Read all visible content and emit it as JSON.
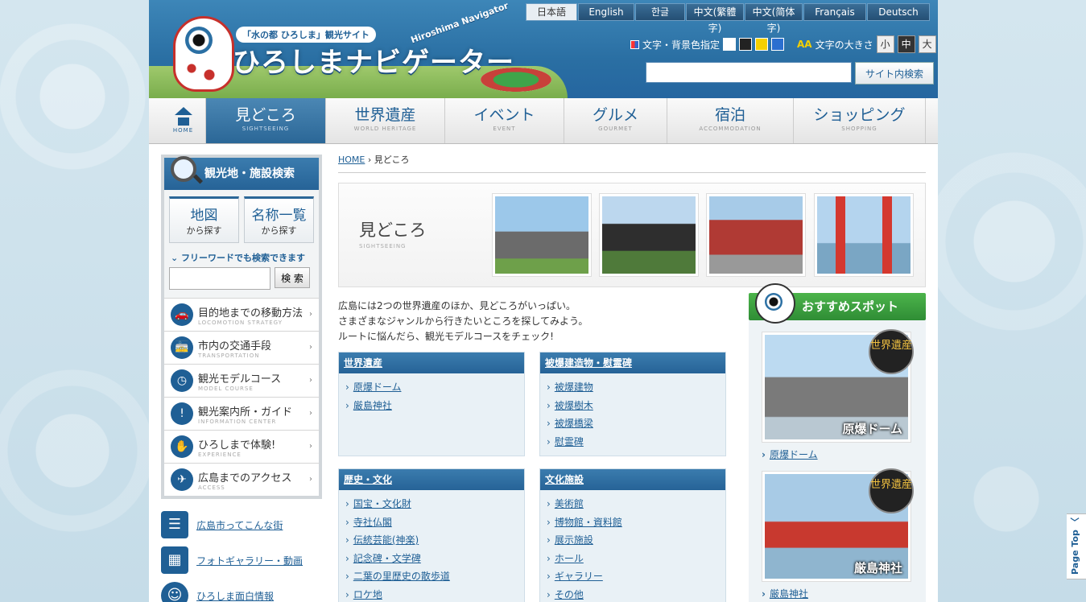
{
  "header": {
    "tagline": "「水の都 ひろしま」観光サイト",
    "site_title": "ひろしまナビゲーター",
    "subtitle": "Hiroshima Navigator",
    "languages": [
      "日本語",
      "English",
      "한글",
      "中文(繁體字)",
      "中文(简体字)",
      "Français",
      "Deutsch"
    ],
    "active_language": "日本語",
    "color_setting_label": "文字・背景色指定",
    "font_size_label": "文字の大きさ",
    "font_sizes": [
      "小",
      "中",
      "大"
    ],
    "active_font_size": "中",
    "search_placeholder": "",
    "search_button": "サイト内検索"
  },
  "nav": {
    "home_label": "HOME",
    "items": [
      {
        "jp": "見どころ",
        "en": "SIGHTSEEING",
        "active": true
      },
      {
        "jp": "世界遺産",
        "en": "WORLD HERITAGE"
      },
      {
        "jp": "イベント",
        "en": "EVENT"
      },
      {
        "jp": "グルメ",
        "en": "GOURMET"
      },
      {
        "jp": "宿泊",
        "en": "ACCOMMODATION"
      },
      {
        "jp": "ショッピング",
        "en": "SHOPPING"
      }
    ]
  },
  "sidebar": {
    "search_title": "観光地・施設検索",
    "map_btn": {
      "main": "地図",
      "sub": "から探す"
    },
    "name_btn": {
      "main": "名称一覧",
      "sub": "から探す"
    },
    "free_word": "フリーワードでも検索できます",
    "free_button": "検 索",
    "menu": [
      {
        "jp": "目的地までの移動方法",
        "en": "LOCOMOTION STRATEGY",
        "icon": "car-icon"
      },
      {
        "jp": "市内の交通手段",
        "en": "TRANSPORTATION",
        "icon": "tram-icon"
      },
      {
        "jp": "観光モデルコース",
        "en": "MODEL COURSE",
        "icon": "clock-icon"
      },
      {
        "jp": "観光案内所・ガイド",
        "en": "INFORMATION CENTER",
        "icon": "info-icon"
      },
      {
        "jp": "ひろしまで体験!",
        "en": "EXPERIENCE",
        "icon": "hand-icon"
      },
      {
        "jp": "広島までのアクセス",
        "en": "ACCESS",
        "icon": "plane-icon"
      }
    ],
    "extras": [
      {
        "label": "広島市ってこんな街",
        "icon": "city-icon"
      },
      {
        "label": "フォトギャラリー・動画",
        "icon": "film-icon"
      },
      {
        "label": "ひろしま面白情報",
        "icon": "smile-icon"
      }
    ]
  },
  "main": {
    "breadcrumb_home": "HOME",
    "breadcrumb_current": "見どころ",
    "hero_title": "見どころ",
    "hero_en": "SIGHTSEEING",
    "intro": [
      "広島には2つの世界遺産のほか、見どころがいっぱい。",
      "さまざまなジャンルから行きたいところを探してみよう。",
      "ルートに悩んだら、観光モデルコースをチェック!"
    ],
    "categories": [
      {
        "title": "世界遺産",
        "links": [
          "原爆ドーム",
          "厳島神社"
        ]
      },
      {
        "title": "被爆建造物・慰霊碑",
        "links": [
          "被爆建物",
          "被爆樹木",
          "被爆橋梁",
          "慰霊碑"
        ]
      },
      {
        "title": "歴史・文化",
        "links": [
          "国宝・文化財",
          "寺社仏閣",
          "伝統芸能(神楽)",
          "記念碑・文学碑",
          "二葉の里歴史の散歩道",
          "ロケ地"
        ]
      },
      {
        "title": "文化施設",
        "links": [
          "美術館",
          "博物館・資料館",
          "展示施設",
          "ホール",
          "ギャラリー",
          "その他"
        ]
      }
    ]
  },
  "recommend": {
    "title": "おすすめスポット",
    "badge": "世界遺産",
    "spots": [
      {
        "caption": "原爆ドーム",
        "link": "原爆ドーム"
      },
      {
        "caption": "厳島神社",
        "link": "厳島神社"
      }
    ]
  },
  "page_top": "Page Top"
}
